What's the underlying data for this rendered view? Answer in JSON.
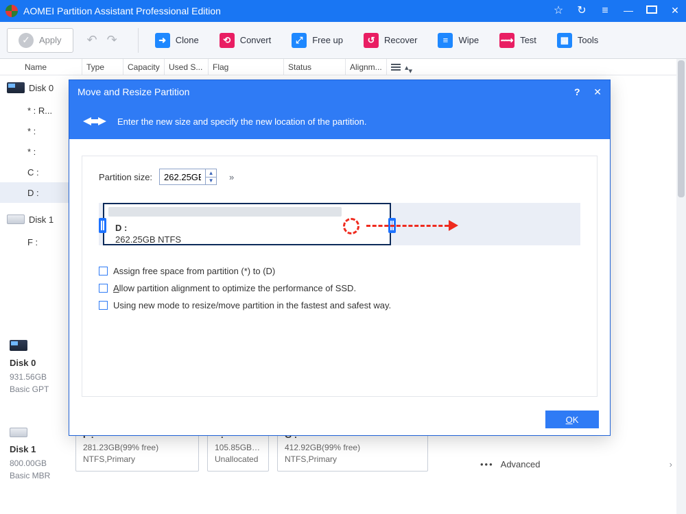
{
  "titlebar": {
    "title": "AOMEI Partition Assistant Professional Edition"
  },
  "toolbar": {
    "apply_label": "Apply",
    "items": [
      {
        "label": "Clone",
        "icon": "clone-icon"
      },
      {
        "label": "Convert",
        "icon": "convert-icon"
      },
      {
        "label": "Free up",
        "icon": "freeup-icon"
      },
      {
        "label": "Recover",
        "icon": "recover-icon"
      },
      {
        "label": "Wipe",
        "icon": "wipe-icon"
      },
      {
        "label": "Test",
        "icon": "test-icon"
      },
      {
        "label": "Tools",
        "icon": "tools-icon"
      }
    ]
  },
  "columns": [
    "Name",
    "Type",
    "Capacity",
    "Used S...",
    "Flag",
    "Status",
    "Alignm..."
  ],
  "tree": {
    "disk0": {
      "name": "Disk 0",
      "parts": [
        "* : R...",
        "* :",
        "* :",
        "C :",
        "D :"
      ]
    },
    "disk1": {
      "name": "Disk 1",
      "parts": [
        "F :"
      ]
    }
  },
  "diskmap0": {
    "name": "Disk 0",
    "size": "931.56GB",
    "type": "Basic GPT"
  },
  "diskmap1": {
    "name": "Disk 1",
    "size": "800.00GB",
    "type": "Basic MBR",
    "segs": [
      {
        "title": "F :",
        "size": "281.23GB(99% free)",
        "fs": "NTFS,Primary"
      },
      {
        "title": "* :",
        "size": "105.85GB(10...",
        "fs": "Unallocated"
      },
      {
        "title": "G :",
        "size": "412.92GB(99% free)",
        "fs": "NTFS,Primary"
      }
    ],
    "advanced": "Advanced"
  },
  "modal": {
    "title": "Move and Resize Partition",
    "subtitle": "Enter the new size and specify the new location of the partition.",
    "psize_label": "Partition size:",
    "psize_value": "262.25GB",
    "bar": {
      "drive": "D :",
      "info": "262.25GB NTFS"
    },
    "cb1": "Assign free space from partition (*) to (D)",
    "cb2": "Allow partition alignment to optimize the performance of SSD.",
    "cb2_prefix": "A",
    "cb3": "Using new mode to resize/move partition in the fastest and safest way.",
    "ok": "OK",
    "ok_u": "O",
    "ok_rest": "K"
  }
}
